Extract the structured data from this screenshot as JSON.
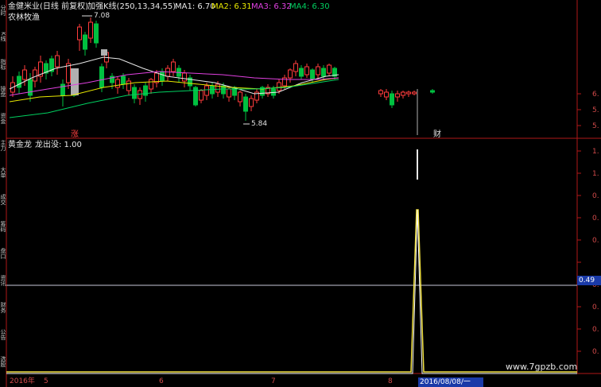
{
  "header": {
    "stock": "金健米业(日线 前复权)",
    "indicator": "加强K线(250,13,34,55)",
    "ma1": "MA1: 6.70",
    "ma2": "MA2: 6.31",
    "ma3": "MA3: 6.32",
    "ma4": "MA4: 6.30"
  },
  "sector": "农林牧渔",
  "annotations": {
    "high": "7.08",
    "low": "5.84",
    "marker_rise": "涨",
    "marker_fin": "财"
  },
  "lower_panel": {
    "name": "黄金龙",
    "signal": "龙出没: 1.00",
    "crosshair_value": "0.49"
  },
  "price_axis": [
    "6.",
    "5.",
    "5."
  ],
  "lower_axis": [
    "1.",
    "1.",
    "0.",
    "0.",
    "0.",
    "0.",
    "0.",
    "0.",
    "0."
  ],
  "time_axis": {
    "year": "2016年",
    "m5": "5",
    "m6": "6",
    "m7": "7",
    "m8": "8",
    "cursor_date": "2016/08/08/一"
  },
  "left_tabs": [
    "分时",
    "K线",
    "指标",
    "操盘",
    "资金",
    "主力",
    "大单",
    "成交",
    "筹码",
    "盘口",
    "资讯",
    "财务",
    "公告",
    "选股"
  ],
  "watermark": "www.7gpzb.com",
  "colors": {
    "up": "#ff3c3c",
    "down": "#00c040",
    "ma1": "#e8e8e8",
    "ma2": "#e8e800",
    "ma3": "#e040e0",
    "ma4": "#00d060",
    "signal": "#f0e040",
    "axis": "#b01818"
  }
}
